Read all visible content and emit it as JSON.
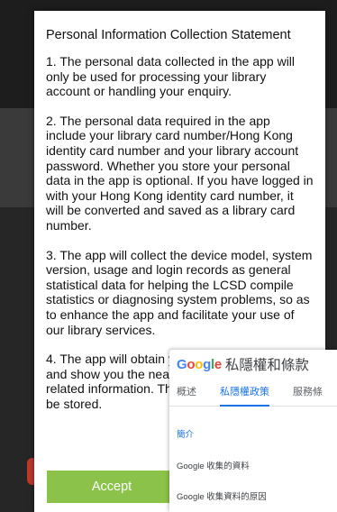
{
  "dialog": {
    "title": "Personal Information Collection Statement",
    "paragraphs": [
      "1. The personal data collected in the app will only be used for processing your library account or handling your enquiry.",
      "2. The personal data required in the app include your library card number/Hong Kong identity card number and your library account password. Whether you store your personal data in the app is optional. If you have logged in with your Hong Kong identity card number, it will be converted and saved as a library card number.",
      "3. The app will collect the device model, system version, usage and login records as general statistical data for helping the LCSD compile statistics or diagnosing system problems, so as to enhance the app and facilitate your use of our library services.",
      "4. The app will obtain your location via GPS and show you the nearest libraries and any related information. The location data will not be stored."
    ],
    "accept_label": "Accept"
  },
  "overlay": {
    "logo_letters": [
      "G",
      "o",
      "o",
      "g",
      "l",
      "e"
    ],
    "logo_colors": [
      "#4285F4",
      "#EA4335",
      "#FBBC05",
      "#4285F4",
      "#34A853",
      "#EA4335"
    ],
    "title": "私隱權和條款",
    "tabs": [
      "概述",
      "私隱權政策",
      "服務條"
    ],
    "active_tab": 1,
    "items": [
      "簡介",
      "Google 收集的資料",
      "Google 收集資料的原因"
    ]
  }
}
